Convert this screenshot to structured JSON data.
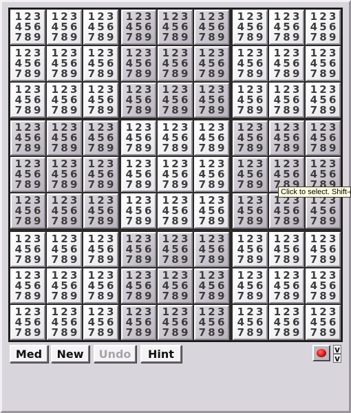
{
  "board": {
    "size": 9,
    "candidate_digits": [
      "1",
      "2",
      "3",
      "4",
      "5",
      "6",
      "7",
      "8",
      "9"
    ],
    "cells_all_show_candidates": true
  },
  "controls": {
    "difficulty_label": "Med",
    "new_label": "New",
    "undo_label": "Undo",
    "undo_enabled": false,
    "hint_label": "Hint",
    "stop_icon": "stop-record-icon",
    "scroll_up": "v",
    "scroll_down": "v"
  },
  "tooltip": {
    "text": "Click to select. Shift-click"
  },
  "colors": {
    "light_cell": "#f0eff2",
    "dark_cell": "#c9c4cd",
    "board_lines": "#2a2a2a",
    "stop_red": "#c40000",
    "tooltip_bg": "#ffffe1"
  }
}
